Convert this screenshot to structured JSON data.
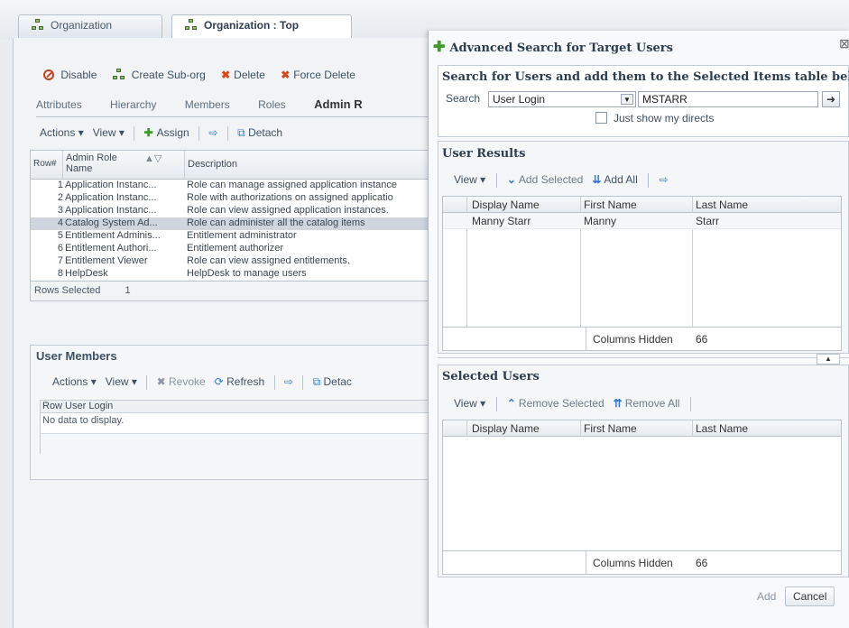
{
  "page": {
    "tabs": [
      {
        "label": "Organization"
      },
      {
        "label": "Organization : Top"
      }
    ],
    "actions": [
      "Disable",
      "Create Sub-org",
      "Delete",
      "Force Delete"
    ],
    "subtabs": [
      "Attributes",
      "Hierarchy",
      "Members",
      "Roles",
      "Admin R"
    ],
    "toolbar": {
      "actions": "Actions",
      "view": "View",
      "assign": "Assign",
      "detach": "Detach"
    },
    "admin_roles_table": {
      "headers": {
        "row": "Row#",
        "name": "Admin Role Name",
        "description": "Description"
      },
      "rows": [
        {
          "num": "1",
          "name": "Application Instanc...",
          "desc": "Role can manage assigned application instance"
        },
        {
          "num": "2",
          "name": "Application Instanc...",
          "desc": "Role with authorizations on assigned applicatio"
        },
        {
          "num": "3",
          "name": "Application Instanc...",
          "desc": "Role can view assigned application instances."
        },
        {
          "num": "4",
          "name": "Catalog System Ad...",
          "desc": "Role can administer all the catalog items"
        },
        {
          "num": "5",
          "name": "Entitlement Adminis...",
          "desc": "Entitlement administrator"
        },
        {
          "num": "6",
          "name": "Entitlement Authori...",
          "desc": "Entitlement authorizer"
        },
        {
          "num": "7",
          "name": "Entitlement Viewer",
          "desc": "Role can view assigned entitlements."
        },
        {
          "num": "8",
          "name": "HelpDesk",
          "desc": "HelpDesk to manage users"
        }
      ],
      "rows_selected_label": "Rows Selected",
      "rows_selected_count": "1"
    },
    "user_members": {
      "title": "User Members",
      "toolbar": {
        "actions": "Actions",
        "view": "View",
        "revoke": "Revoke",
        "refresh": "Refresh",
        "detach": "Detac"
      },
      "header": "Row User Login",
      "empty": "No data to display."
    }
  },
  "dialog": {
    "title": "Advanced Search for Target Users",
    "instructions": "Search for Users and add them to the Selected Items table below.",
    "search_label": "Search",
    "search_by": "User Login",
    "search_value": "MSTARR",
    "directs_label": "Just show my directs",
    "user_results": {
      "title": "User Results",
      "toolbar": {
        "view": "View",
        "add_selected": "Add Selected",
        "add_all": "Add All"
      },
      "columns": [
        "Display Name",
        "First Name",
        "Last Name"
      ],
      "rows": [
        {
          "display": "Manny Starr",
          "first": "Manny",
          "last": "Starr"
        }
      ],
      "columns_hidden_label": "Columns Hidden",
      "columns_hidden_count": "66"
    },
    "selected_users": {
      "title": "Selected Users",
      "toolbar": {
        "view": "View",
        "remove_selected": "Remove Selected",
        "remove_all": "Remove All"
      },
      "columns": [
        "Display Name",
        "First Name",
        "Last Name"
      ],
      "columns_hidden_label": "Columns Hidden",
      "columns_hidden_count": "66"
    },
    "buttons": {
      "add": "Add",
      "cancel": "Cancel"
    }
  }
}
